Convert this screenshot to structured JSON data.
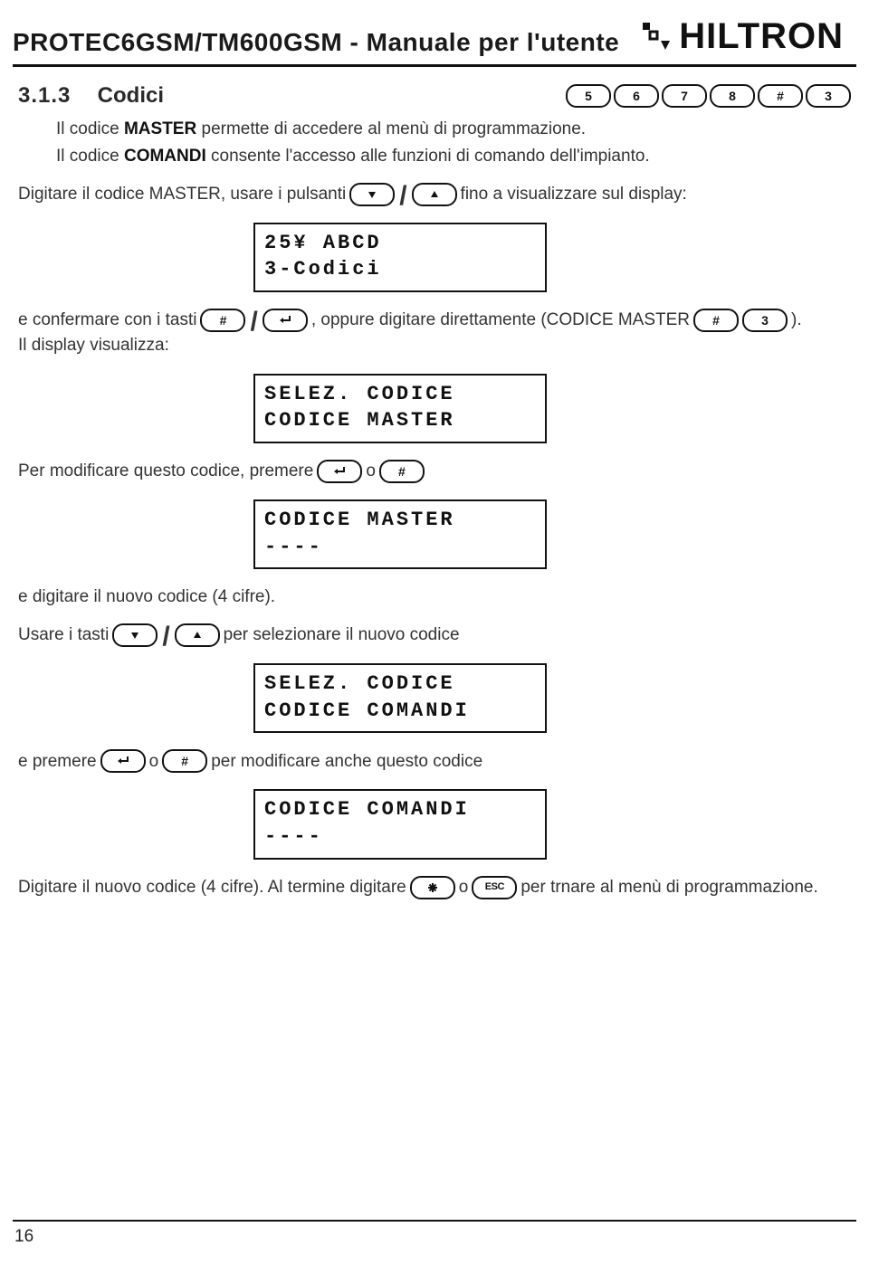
{
  "header": {
    "title": "PROTEC6GSM/TM600GSM - Manuale per l'utente",
    "brand": "HILTRON"
  },
  "section": {
    "number": "3.1.3",
    "title": "Codici"
  },
  "keyseq": [
    "5",
    "6",
    "7",
    "8",
    "#",
    "3"
  ],
  "p1a": "Il codice ",
  "p1b": "MASTER",
  "p1c": " permette di accedere al menù di programmazione.",
  "p2a": "Il codice ",
  "p2b": "COMANDI",
  "p2c": " consente l'accesso alle funzioni di comando dell'impianto.",
  "p3a": "Digitare il codice MASTER, usare i pulsanti ",
  "p3b": " fino a visualizzare sul display:",
  "lcd1": {
    "l1": "25¥ ABCD",
    "l2": "3-Codici"
  },
  "p4a": "e confermare con i tasti ",
  "p4b": ", oppure digitare direttamente (CODICE MASTER",
  "p4c": " ).",
  "p5": "Il display visualizza:",
  "lcd2": {
    "l1": "SELEZ. CODICE",
    "l2": "CODICE MASTER"
  },
  "p6a": "Per modificare questo codice, premere ",
  "p6b": " o ",
  "lcd3": {
    "l1": "CODICE MASTER",
    "l2": "----"
  },
  "p7": "e digitare il nuovo codice (4 cifre).",
  "p8a": "Usare i tasti ",
  "p8b": " per selezionare il nuovo codice",
  "lcd4": {
    "l1": "SELEZ. CODICE",
    "l2": "CODICE COMANDI"
  },
  "p9a": "e premere",
  "p9b": " o ",
  "p9c": " per modificare anche questo codice",
  "lcd5": {
    "l1": "CODICE COMANDI",
    "l2": "----"
  },
  "p10a": "Digitare il nuovo codice (4 cifre). Al termine digitare ",
  "p10b": "  o ",
  "p10c": " per trnare al menù di programmazione.",
  "esc": "ESC",
  "page": "16"
}
